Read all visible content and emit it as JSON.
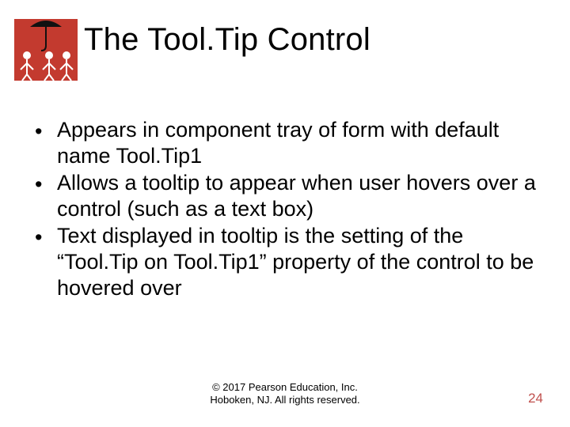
{
  "title": "The Tool.Tip Control",
  "bullets": [
    "Appears in component tray of form with default name Tool.Tip1",
    "Allows a tooltip to appear when user hovers over a control (such as a text box)",
    "Text displayed in tooltip is the setting of the “Tool.Tip on Tool.Tip1” property of the control to be hovered over"
  ],
  "footer_line1": "© 2017 Pearson Education, Inc.",
  "footer_line2": "Hoboken, NJ. All rights reserved.",
  "page_number": "24"
}
